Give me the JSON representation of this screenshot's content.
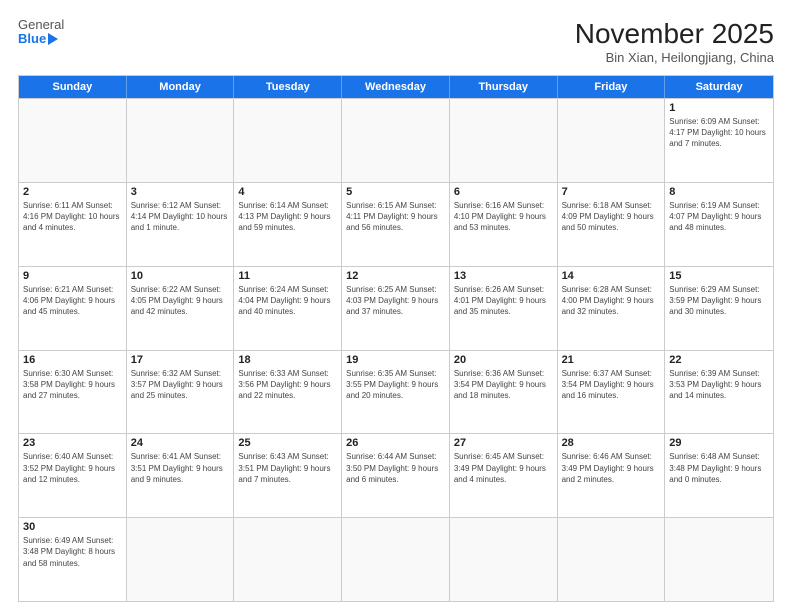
{
  "header": {
    "logo_general": "General",
    "logo_blue": "Blue",
    "title": "November 2025",
    "subtitle": "Bin Xian, Heilongjiang, China"
  },
  "calendar": {
    "days_of_week": [
      "Sunday",
      "Monday",
      "Tuesday",
      "Wednesday",
      "Thursday",
      "Friday",
      "Saturday"
    ],
    "rows": [
      [
        {
          "day": "",
          "info": ""
        },
        {
          "day": "",
          "info": ""
        },
        {
          "day": "",
          "info": ""
        },
        {
          "day": "",
          "info": ""
        },
        {
          "day": "",
          "info": ""
        },
        {
          "day": "",
          "info": ""
        },
        {
          "day": "1",
          "info": "Sunrise: 6:09 AM\nSunset: 4:17 PM\nDaylight: 10 hours and 7 minutes."
        }
      ],
      [
        {
          "day": "2",
          "info": "Sunrise: 6:11 AM\nSunset: 4:16 PM\nDaylight: 10 hours and 4 minutes."
        },
        {
          "day": "3",
          "info": "Sunrise: 6:12 AM\nSunset: 4:14 PM\nDaylight: 10 hours and 1 minute."
        },
        {
          "day": "4",
          "info": "Sunrise: 6:14 AM\nSunset: 4:13 PM\nDaylight: 9 hours and 59 minutes."
        },
        {
          "day": "5",
          "info": "Sunrise: 6:15 AM\nSunset: 4:11 PM\nDaylight: 9 hours and 56 minutes."
        },
        {
          "day": "6",
          "info": "Sunrise: 6:16 AM\nSunset: 4:10 PM\nDaylight: 9 hours and 53 minutes."
        },
        {
          "day": "7",
          "info": "Sunrise: 6:18 AM\nSunset: 4:09 PM\nDaylight: 9 hours and 50 minutes."
        },
        {
          "day": "8",
          "info": "Sunrise: 6:19 AM\nSunset: 4:07 PM\nDaylight: 9 hours and 48 minutes."
        }
      ],
      [
        {
          "day": "9",
          "info": "Sunrise: 6:21 AM\nSunset: 4:06 PM\nDaylight: 9 hours and 45 minutes."
        },
        {
          "day": "10",
          "info": "Sunrise: 6:22 AM\nSunset: 4:05 PM\nDaylight: 9 hours and 42 minutes."
        },
        {
          "day": "11",
          "info": "Sunrise: 6:24 AM\nSunset: 4:04 PM\nDaylight: 9 hours and 40 minutes."
        },
        {
          "day": "12",
          "info": "Sunrise: 6:25 AM\nSunset: 4:03 PM\nDaylight: 9 hours and 37 minutes."
        },
        {
          "day": "13",
          "info": "Sunrise: 6:26 AM\nSunset: 4:01 PM\nDaylight: 9 hours and 35 minutes."
        },
        {
          "day": "14",
          "info": "Sunrise: 6:28 AM\nSunset: 4:00 PM\nDaylight: 9 hours and 32 minutes."
        },
        {
          "day": "15",
          "info": "Sunrise: 6:29 AM\nSunset: 3:59 PM\nDaylight: 9 hours and 30 minutes."
        }
      ],
      [
        {
          "day": "16",
          "info": "Sunrise: 6:30 AM\nSunset: 3:58 PM\nDaylight: 9 hours and 27 minutes."
        },
        {
          "day": "17",
          "info": "Sunrise: 6:32 AM\nSunset: 3:57 PM\nDaylight: 9 hours and 25 minutes."
        },
        {
          "day": "18",
          "info": "Sunrise: 6:33 AM\nSunset: 3:56 PM\nDaylight: 9 hours and 22 minutes."
        },
        {
          "day": "19",
          "info": "Sunrise: 6:35 AM\nSunset: 3:55 PM\nDaylight: 9 hours and 20 minutes."
        },
        {
          "day": "20",
          "info": "Sunrise: 6:36 AM\nSunset: 3:54 PM\nDaylight: 9 hours and 18 minutes."
        },
        {
          "day": "21",
          "info": "Sunrise: 6:37 AM\nSunset: 3:54 PM\nDaylight: 9 hours and 16 minutes."
        },
        {
          "day": "22",
          "info": "Sunrise: 6:39 AM\nSunset: 3:53 PM\nDaylight: 9 hours and 14 minutes."
        }
      ],
      [
        {
          "day": "23",
          "info": "Sunrise: 6:40 AM\nSunset: 3:52 PM\nDaylight: 9 hours and 12 minutes."
        },
        {
          "day": "24",
          "info": "Sunrise: 6:41 AM\nSunset: 3:51 PM\nDaylight: 9 hours and 9 minutes."
        },
        {
          "day": "25",
          "info": "Sunrise: 6:43 AM\nSunset: 3:51 PM\nDaylight: 9 hours and 7 minutes."
        },
        {
          "day": "26",
          "info": "Sunrise: 6:44 AM\nSunset: 3:50 PM\nDaylight: 9 hours and 6 minutes."
        },
        {
          "day": "27",
          "info": "Sunrise: 6:45 AM\nSunset: 3:49 PM\nDaylight: 9 hours and 4 minutes."
        },
        {
          "day": "28",
          "info": "Sunrise: 6:46 AM\nSunset: 3:49 PM\nDaylight: 9 hours and 2 minutes."
        },
        {
          "day": "29",
          "info": "Sunrise: 6:48 AM\nSunset: 3:48 PM\nDaylight: 9 hours and 0 minutes."
        }
      ],
      [
        {
          "day": "30",
          "info": "Sunrise: 6:49 AM\nSunset: 3:48 PM\nDaylight: 8 hours and 58 minutes."
        },
        {
          "day": "",
          "info": ""
        },
        {
          "day": "",
          "info": ""
        },
        {
          "day": "",
          "info": ""
        },
        {
          "day": "",
          "info": ""
        },
        {
          "day": "",
          "info": ""
        },
        {
          "day": "",
          "info": ""
        }
      ]
    ]
  }
}
